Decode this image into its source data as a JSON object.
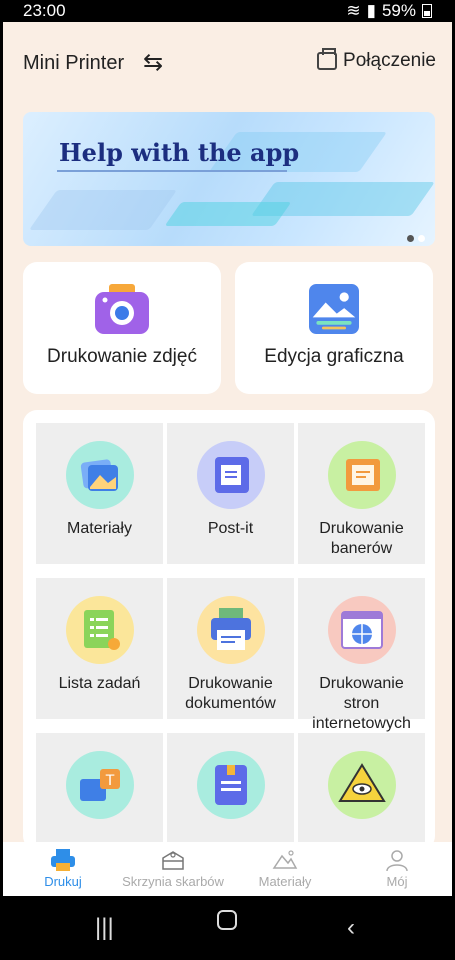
{
  "status": {
    "time": "23:00",
    "battery": "59%"
  },
  "header": {
    "title": "Mini Printer",
    "connect_label": "Połączenie"
  },
  "banner": {
    "title": "Help with the app"
  },
  "cards": [
    {
      "label": "Drukowanie zdjęć"
    },
    {
      "label": "Edycja graficzna"
    }
  ],
  "tiles": [
    {
      "label": "Materiały"
    },
    {
      "label": "Post-it"
    },
    {
      "label": "Drukowanie banerów"
    },
    {
      "label": "Lista zadań"
    },
    {
      "label": "Drukowanie dokumentów"
    },
    {
      "label": "Drukowanie stron internetowych"
    }
  ],
  "bottom_nav": [
    {
      "label": "Drukuj"
    },
    {
      "label": "Skrzynia skarbów"
    },
    {
      "label": "Materiały"
    },
    {
      "label": "Mój"
    }
  ],
  "colors": {
    "accent": "#2e8ee8",
    "background": "#faeee4"
  }
}
